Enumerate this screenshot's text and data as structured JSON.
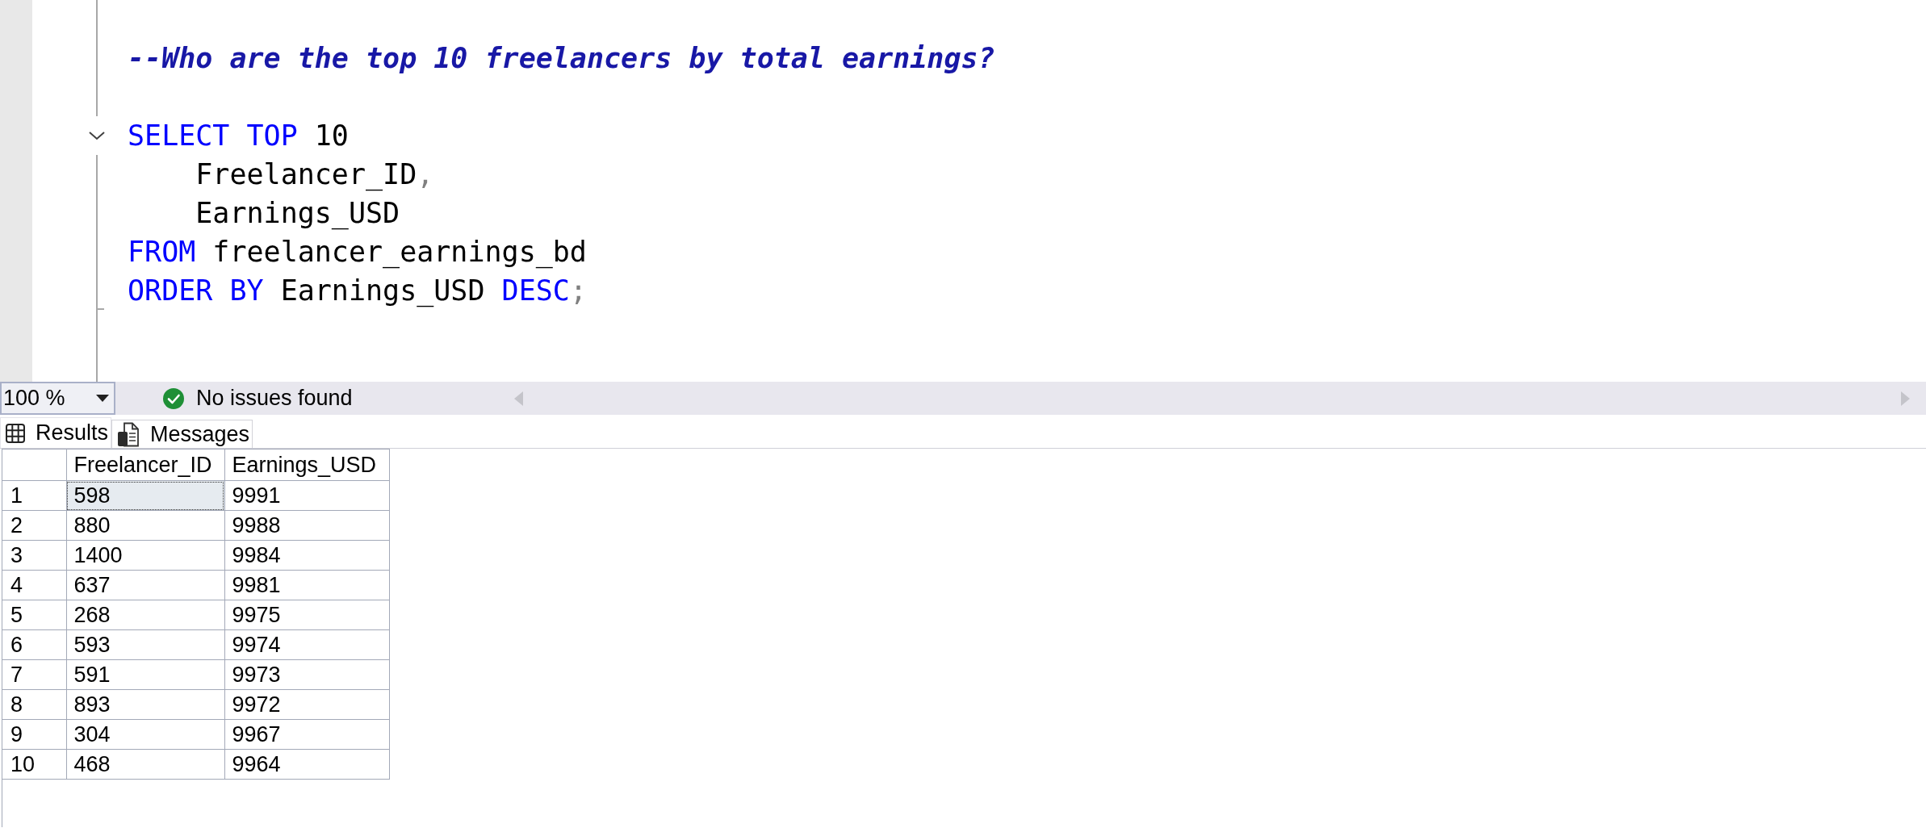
{
  "editor": {
    "lines": [
      {
        "kind": "code",
        "tokens": [
          {
            "kind": "comment",
            "text": "--Who are the top 10 freelancers by total earnings?"
          }
        ]
      },
      {
        "kind": "blank"
      },
      {
        "kind": "code",
        "expanded": true,
        "tokens": [
          {
            "kind": "keyword",
            "text": "SELECT TOP "
          },
          {
            "kind": "number",
            "text": "10"
          }
        ],
        "children": [
          {
            "kind": "code",
            "tokens": [
              {
                "kind": "identifier",
                "text": "    Freelancer_ID"
              },
              {
                "kind": "punctuation",
                "text": ","
              }
            ]
          },
          {
            "kind": "code",
            "tokens": [
              {
                "kind": "identifier",
                "text": "    Earnings_USD"
              }
            ]
          },
          {
            "kind": "code",
            "tokens": [
              {
                "kind": "keyword",
                "text": "FROM "
              },
              {
                "kind": "identifier",
                "text": "freelancer_earnings_bd"
              }
            ]
          },
          {
            "kind": "code",
            "tokens": [
              {
                "kind": "keyword",
                "text": "ORDER BY "
              },
              {
                "kind": "identifier",
                "text": "Earnings_USD "
              },
              {
                "kind": "keyword",
                "text": "DESC"
              },
              {
                "kind": "punctuation",
                "text": ";"
              }
            ]
          }
        ]
      }
    ]
  },
  "status_bar": {
    "zoom": {
      "value": "100 %"
    },
    "message": {
      "text": "No issues found"
    }
  },
  "results": {
    "tabs": [
      {
        "label": "Results",
        "kind": "grid",
        "selected": true
      },
      {
        "label": "Messages",
        "kind": "text",
        "selected": false
      }
    ],
    "grid": {
      "columns": [
        "Freelancer_ID",
        "Earnings_USD"
      ],
      "rows": [
        {
          "number": "1",
          "cells": [
            {
              "text": "598",
              "selected": true
            },
            {
              "text": "9991",
              "selected": false
            }
          ]
        },
        {
          "number": "2",
          "cells": [
            {
              "text": "880",
              "selected": false
            },
            {
              "text": "9988",
              "selected": false
            }
          ]
        },
        {
          "number": "3",
          "cells": [
            {
              "text": "1400",
              "selected": false
            },
            {
              "text": "9984",
              "selected": false
            }
          ]
        },
        {
          "number": "4",
          "cells": [
            {
              "text": "637",
              "selected": false
            },
            {
              "text": "9981",
              "selected": false
            }
          ]
        },
        {
          "number": "5",
          "cells": [
            {
              "text": "268",
              "selected": false
            },
            {
              "text": "9975",
              "selected": false
            }
          ]
        },
        {
          "number": "6",
          "cells": [
            {
              "text": "593",
              "selected": false
            },
            {
              "text": "9974",
              "selected": false
            }
          ]
        },
        {
          "number": "7",
          "cells": [
            {
              "text": "591",
              "selected": false
            },
            {
              "text": "9973",
              "selected": false
            }
          ]
        },
        {
          "number": "8",
          "cells": [
            {
              "text": "893",
              "selected": false
            },
            {
              "text": "9972",
              "selected": false
            }
          ]
        },
        {
          "number": "9",
          "cells": [
            {
              "text": "304",
              "selected": false
            },
            {
              "text": "9967",
              "selected": false
            }
          ]
        },
        {
          "number": "10",
          "cells": [
            {
              "text": "468",
              "selected": false
            },
            {
              "text": "9964",
              "selected": false
            }
          ]
        }
      ]
    }
  }
}
